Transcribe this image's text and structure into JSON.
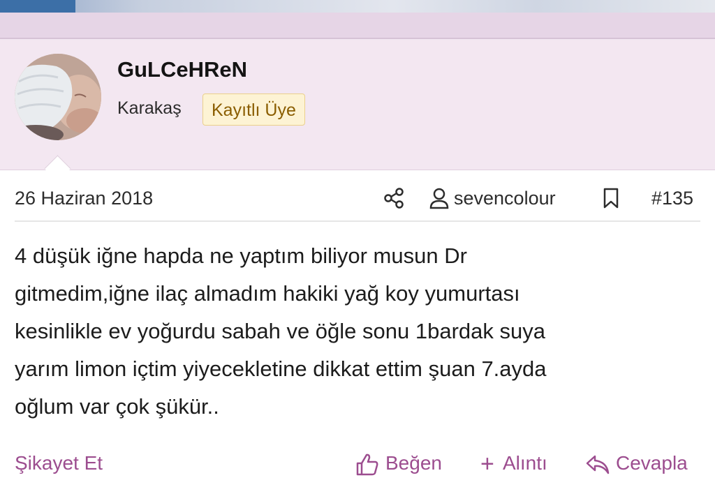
{
  "user": {
    "name": "GuLCeHReN",
    "location": "Karakaş",
    "badge": "Kayıtlı Üye"
  },
  "post": {
    "date": "26 Haziran 2018",
    "author": "sevencolour",
    "number": "#135",
    "lines": [
      "4 düşük iğne hapda ne yaptım biliyor musun Dr",
      "gitmedim,iğne ilaç almadım hakiki yağ koy yumurtası",
      "kesinlikle ev yoğurdu sabah ve öğle sonu 1bardak suya",
      "yarım limon içtim yiyecekletine dikkat ettim şuan 7.ayda",
      "oğlum var çok şükür.."
    ]
  },
  "actions": {
    "report": "Şikayet Et",
    "like": "Beğen",
    "quote": "Alıntı",
    "reply": "Cevapla"
  },
  "icons": {
    "share": "share-icon",
    "user": "user-icon",
    "bookmark": "bookmark-icon",
    "like": "thumbs-up-icon",
    "quote": "plus-icon",
    "reply": "reply-icon"
  },
  "colors": {
    "header_band": "#e6d5e6",
    "user_area": "#f3e7f1",
    "action_link": "#9c4d8f",
    "badge_bg": "#fdf3d4",
    "badge_text": "#8a5d00"
  }
}
